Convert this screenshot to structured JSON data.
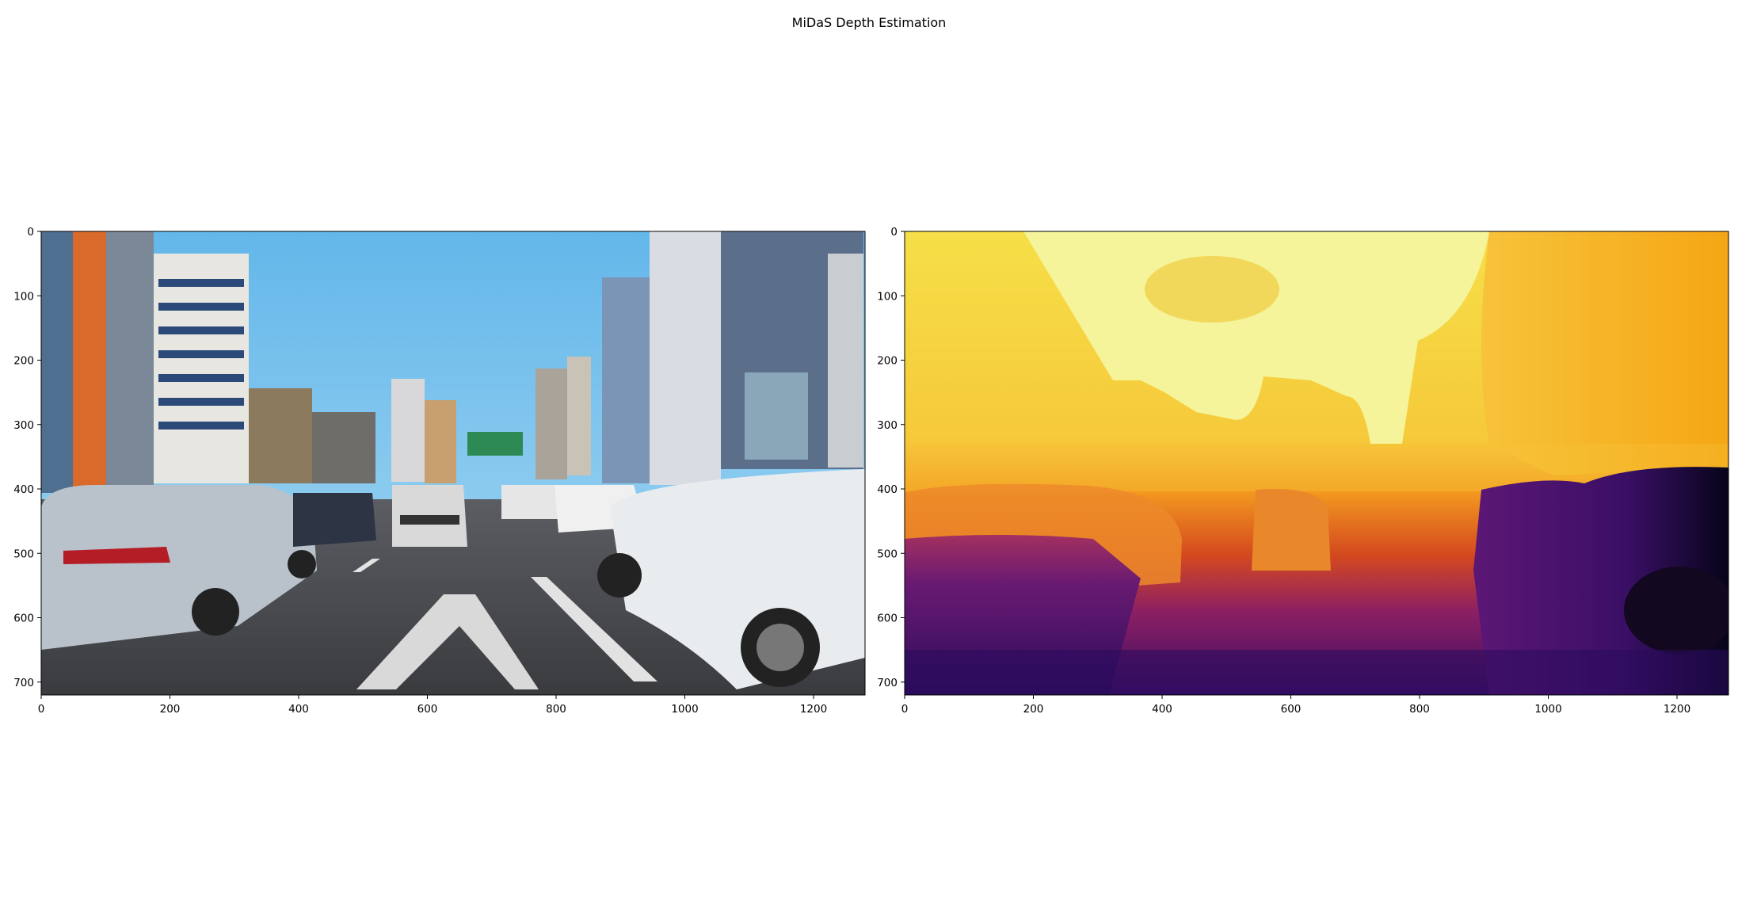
{
  "figure": {
    "title": "MiDaS Depth Estimation"
  },
  "chart_data": [
    {
      "type": "image",
      "content": "street scene photo",
      "xlim": [
        0,
        1280
      ],
      "ylim": [
        720,
        0
      ],
      "xticks": [
        "0",
        "200",
        "400",
        "600",
        "800",
        "1000",
        "1200"
      ],
      "yticks": [
        "0",
        "100",
        "200",
        "300",
        "400",
        "500",
        "600",
        "700"
      ]
    },
    {
      "type": "heatmap",
      "content": "depth map",
      "colormap": "inferno",
      "xlim": [
        0,
        1280
      ],
      "ylim": [
        720,
        0
      ],
      "xticks": [
        "0",
        "200",
        "400",
        "600",
        "800",
        "1000",
        "1200"
      ],
      "yticks": [
        "0",
        "100",
        "200",
        "300",
        "400",
        "500",
        "600",
        "700"
      ]
    }
  ],
  "colors": {
    "sky": "#7cc6ef",
    "road": "#4b4d52",
    "far": "#f6f39a",
    "mid": "#f5b52e",
    "near": "#27105a"
  }
}
